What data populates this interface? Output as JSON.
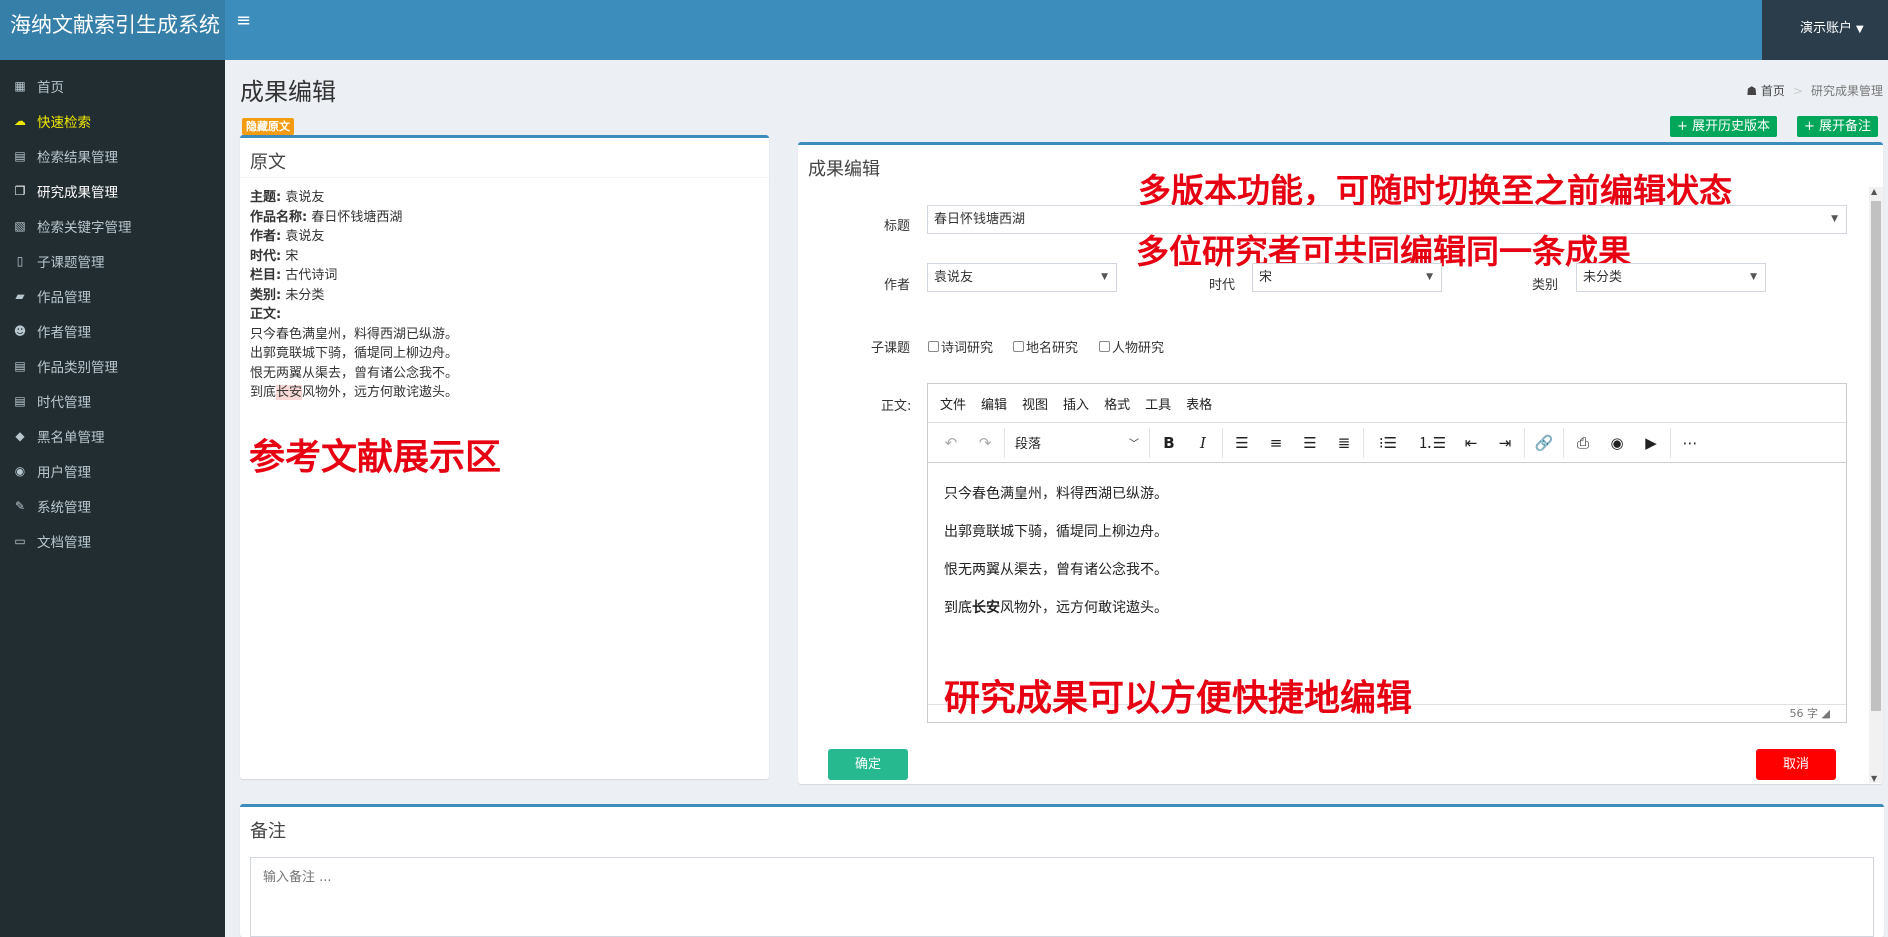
{
  "app": {
    "title": "海纳文献索引生成系统",
    "menu_toggle": "≡",
    "user": "演示账户"
  },
  "sidebar": {
    "items": [
      {
        "label": "首页",
        "icon": "dashboard-icon"
      },
      {
        "label": "快速检索",
        "icon": "cloud-icon"
      },
      {
        "label": "检索结果管理",
        "icon": "file-icon"
      },
      {
        "label": "研究成果管理",
        "icon": "copy-icon"
      },
      {
        "label": "检索关键字管理",
        "icon": "image-file-icon"
      },
      {
        "label": "子课题管理",
        "icon": "book-icon"
      },
      {
        "label": "作品管理",
        "icon": "book-icon"
      },
      {
        "label": "作者管理",
        "icon": "users-icon"
      },
      {
        "label": "作品类别管理",
        "icon": "file-icon"
      },
      {
        "label": "时代管理",
        "icon": "file-icon"
      },
      {
        "label": "黑名单管理",
        "icon": "tags-icon"
      },
      {
        "label": "用户管理",
        "icon": "user-circle-icon"
      },
      {
        "label": "系统管理",
        "icon": "edit-icon"
      },
      {
        "label": "文档管理",
        "icon": "folder-open-icon"
      }
    ]
  },
  "page": {
    "title": "成果编辑"
  },
  "breadcrumb": {
    "home": "首页",
    "sep": ">",
    "current": "研究成果管理"
  },
  "buttons": {
    "hide_source": "隐藏原文",
    "history": "+ 展开历史版本",
    "notes": "+ 展开备注",
    "confirm": "确定",
    "cancel": "取消"
  },
  "source": {
    "title": "原文",
    "fields": [
      {
        "label": "主题:",
        "value": "袁说友"
      },
      {
        "label": "作品名称:",
        "value": "春日怀钱塘西湖"
      },
      {
        "label": "作者:",
        "value": "袁说友"
      },
      {
        "label": "时代:",
        "value": "宋"
      },
      {
        "label": "栏目:",
        "value": "古代诗词"
      },
      {
        "label": "类别:",
        "value": "未分类"
      }
    ],
    "body_label": "正文:",
    "lines": [
      "只今春色满皇州，料得西湖已纵游。",
      "出郭竟联城下骑，循堤同上柳边舟。",
      "恨无两翼从渠去，曾有诸公念我不。"
    ],
    "last_line": {
      "before": "到底",
      "highlight": "长安",
      "after": "风物外，远方何敢诧遨头。"
    }
  },
  "editor": {
    "title": "成果编辑",
    "title_label": "标题",
    "title_value": "春日怀钱塘西湖",
    "author_label": "作者",
    "author_value": "袁说友",
    "era_label": "时代",
    "era_value": "宋",
    "category_label": "类别",
    "category_value": "未分类",
    "subtopic_label": "子课题",
    "subtopics": [
      "诗词研究",
      "地名研究",
      "人物研究"
    ],
    "body_label": "正文:",
    "menus": [
      "文件",
      "编辑",
      "视图",
      "插入",
      "格式",
      "工具",
      "表格"
    ],
    "format_select": "段落",
    "lines": [
      "只今春色满皇州，料得西湖已纵游。",
      "出郭竟联城下骑，循堤同上柳边舟。",
      "恨无两翼从渠去，曾有诸公念我不。"
    ],
    "last_line": {
      "before": "到底",
      "bold": "长安",
      "after": "风物外，远方何敢诧遨头。"
    },
    "word_count": "56 字"
  },
  "annotations": {
    "versions": "多版本功能，可随时切换至之前编辑状态",
    "collab": "多位研究者可共同编辑同一条成果",
    "source_area": "参考文献展示区",
    "edit_easy": "研究成果可以方便快捷地编辑"
  },
  "notes": {
    "title": "备注",
    "placeholder": "输入备注 ..."
  },
  "colors": {
    "header": "#3c8dbc",
    "sidebar": "#222d32",
    "success": "#00a65a",
    "warning": "#f39c12",
    "danger": "#ff0000",
    "annotation": "#e60012"
  }
}
